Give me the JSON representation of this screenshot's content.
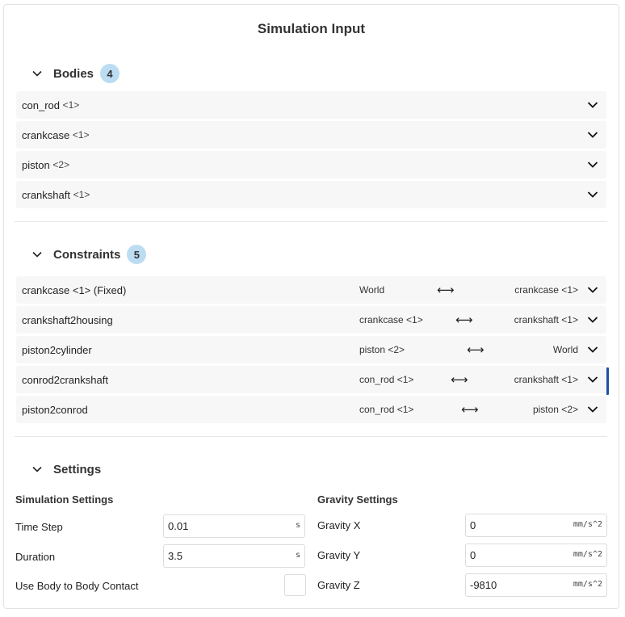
{
  "title": "Simulation Input",
  "bodies": {
    "label": "Bodies",
    "count": "4",
    "items": [
      {
        "name": "con_rod",
        "instance": "<1>"
      },
      {
        "name": "crankcase",
        "instance": "<1>"
      },
      {
        "name": "piston",
        "instance": "<2>"
      },
      {
        "name": "crankshaft",
        "instance": "<1>"
      }
    ]
  },
  "constraints": {
    "label": "Constraints",
    "count": "5",
    "arrow": "⟷",
    "items": [
      {
        "name": "crankcase <1> (Fixed)",
        "left": "World",
        "right": "crankcase <1>",
        "selected": false
      },
      {
        "name": "crankshaft2housing",
        "left": "crankcase <1>",
        "right": "crankshaft <1>",
        "selected": false
      },
      {
        "name": "piston2cylinder",
        "left": "piston <2>",
        "right": "World",
        "selected": false
      },
      {
        "name": "conrod2crankshaft",
        "left": "con_rod <1>",
        "right": "crankshaft <1>",
        "selected": true
      },
      {
        "name": "piston2conrod",
        "left": "con_rod <1>",
        "right": "piston <2>",
        "selected": false
      }
    ]
  },
  "settings": {
    "label": "Settings",
    "simulation": {
      "heading": "Simulation Settings",
      "time_step": {
        "label": "Time Step",
        "value": "0.01",
        "unit": "s"
      },
      "duration": {
        "label": "Duration",
        "value": "3.5",
        "unit": "s"
      },
      "contact": {
        "label": "Use Body to Body Contact",
        "checked": false
      }
    },
    "gravity": {
      "heading": "Gravity Settings",
      "x": {
        "label": "Gravity X",
        "value": "0",
        "unit": "mm/s^2"
      },
      "y": {
        "label": "Gravity Y",
        "value": "0",
        "unit": "mm/s^2"
      },
      "z": {
        "label": "Gravity Z",
        "value": "-9810",
        "unit": "mm/s^2"
      }
    }
  },
  "colors": {
    "badge": "#bcdcf2",
    "row_bg": "#f7f7f7",
    "selected_indicator": "#1f4fa8"
  }
}
